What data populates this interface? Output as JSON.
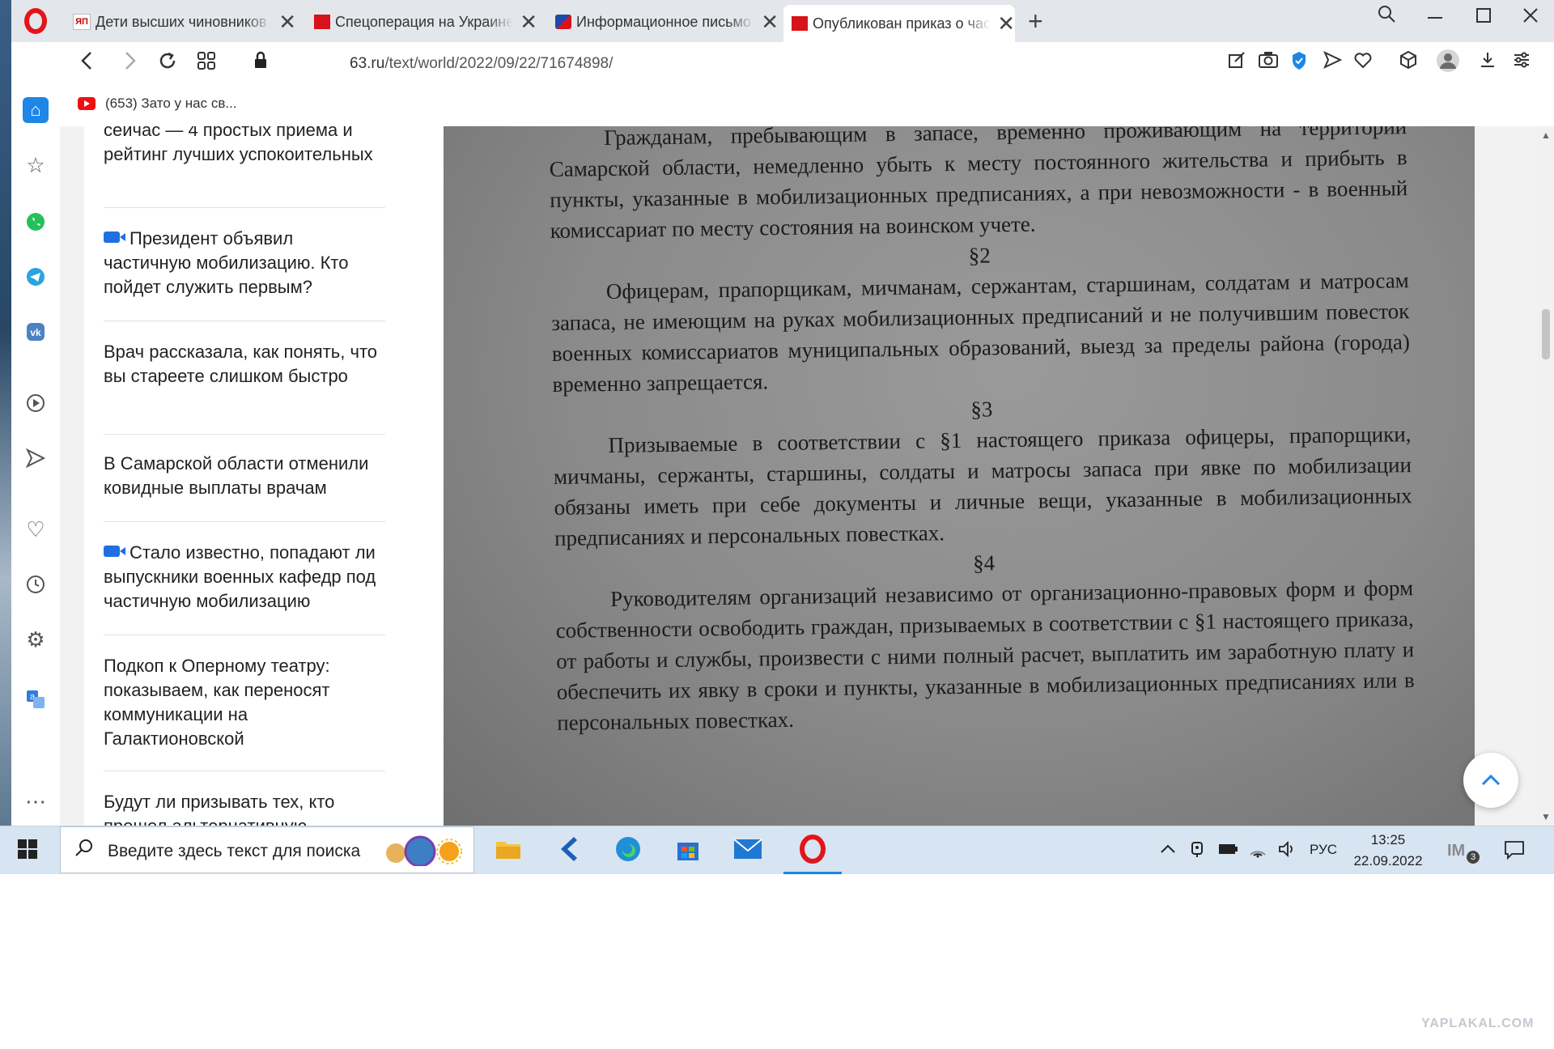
{
  "tabs": [
    {
      "title": "Дети высших чиновников",
      "active": false
    },
    {
      "title": "Спецоперация на Украине",
      "active": false
    },
    {
      "title": "Информационное письмо",
      "active": false
    },
    {
      "title": "Опубликован приказ о частичной",
      "active": true
    }
  ],
  "address": {
    "host": "63.ru",
    "path": "/text/world/2022/09/22/71674898/"
  },
  "bookmark": {
    "label": "(653) Зато у нас св..."
  },
  "sidebar_icons": [
    "home-icon",
    "star-icon",
    "whatsapp-icon",
    "telegram-icon",
    "vk-icon",
    "player-icon",
    "send-icon",
    "heart-icon",
    "history-icon",
    "settings-icon",
    "translate-icon",
    "more-icon"
  ],
  "news": [
    {
      "text": "сейчас — 4 простых приема и рейтинг лучших успокоительных",
      "video": false
    },
    {
      "text": "Президент объявил частичную мобилизацию. Кто пойдет служить первым?",
      "video": true
    },
    {
      "text": "Врач рассказала, как понять, что вы стареете слишком быстро",
      "video": false
    },
    {
      "text": "В Самарской области отменили ковидные выплаты врачам",
      "video": false
    },
    {
      "text": "Стало известно, попадают ли выпускники военных кафедр под частичную мобилизацию",
      "video": true
    },
    {
      "text": "Подкоп к Оперному театру: показываем, как переносят коммуникации на Галактионовской",
      "video": false
    },
    {
      "text": "Будут ли призывать тех, кто прошел альтернативную",
      "video": false
    }
  ],
  "document": {
    "p0": "Гражданам, пребывающим в запасе, временно проживающим на территории Самарской области, немедленно убыть к месту постоянного жительства и прибыть в пункты, указанные в мобилизационных предписаниях, а при невозможности - в военный комиссариат по месту состояния на воинском учете.",
    "s2": "§2",
    "p2": "Офицерам, прапорщикам, мичманам, сержантам, старшинам, солдатам и матросам запаса, не имеющим на руках мобилизационных предписаний и не получившим повесток военных комиссариатов муниципальных образований, выезд за пределы района (города) временно запрещается.",
    "s3": "§3",
    "p3": "Призываемые в соответствии с §1 настоящего приказа офицеры, прапорщики, мичманы, сержанты, старшины, солдаты и матросы запаса при явке по мобилизации обязаны иметь при себе документы и личные вещи, указанные в мобилизационных предписаниях и персональных повестках.",
    "s4": "§4",
    "p4": "Руководителям организаций независимо от организационно-правовых форм и форм собственности освободить граждан, призываемых в соответствии с §1 настоящего приказа, от работы и службы, произвести с ними полный расчет, выплатить им заработную плату и обеспечить их явку в сроки и пункты, указанные в мобилизационных предписаниях или в персональных повестках."
  },
  "taskbar": {
    "search_placeholder": "Введите здесь текст для поиска",
    "lang": "РУС",
    "time": "13:25",
    "date": "22.09.2022",
    "notification_count": "3"
  },
  "watermark": "YAPLAKAL.COM",
  "colors": {
    "opera_red": "#e3141a",
    "accent": "#1d86e6",
    "taskbar": "#d7e4f2"
  }
}
